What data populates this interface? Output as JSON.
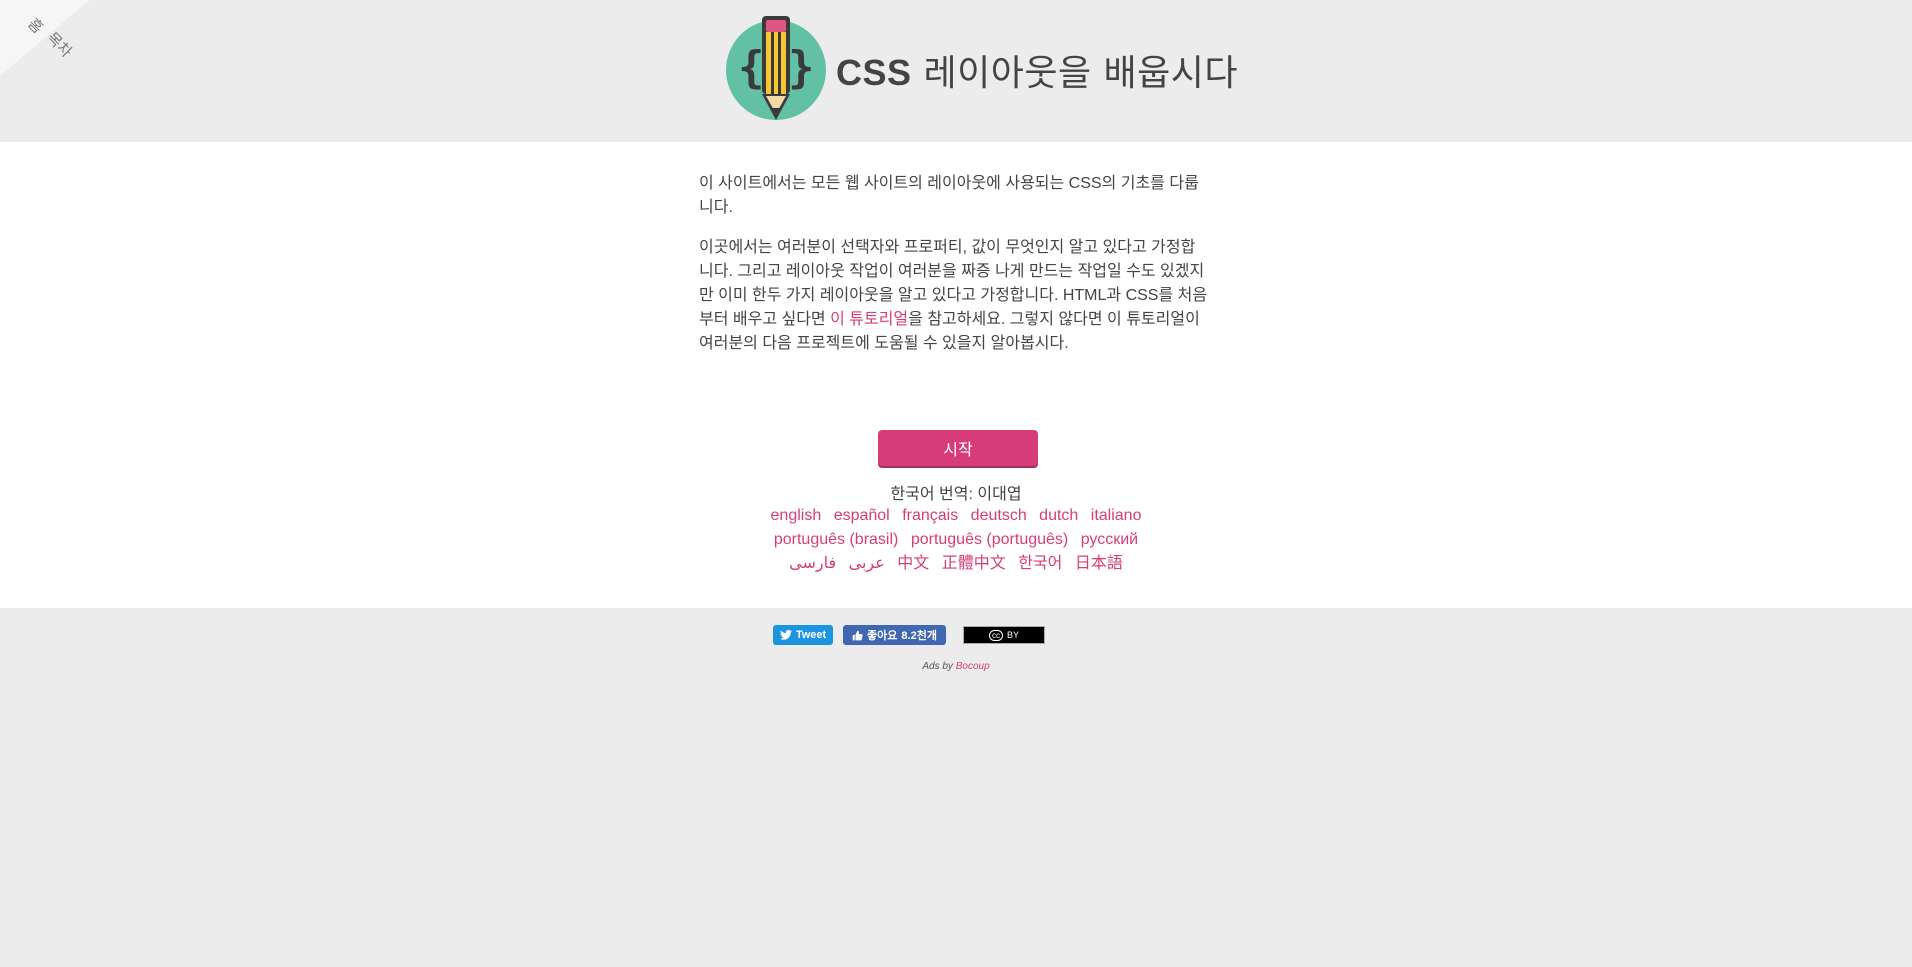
{
  "corner": {
    "toc_line1": "홈",
    "toc_line2": "목차"
  },
  "header": {
    "title_bold": "CSS",
    "title_rest": "레이아웃을 배웁시다"
  },
  "intro": {
    "p1": "이 사이트에서는 모든 웹 사이트의 레이아웃에 사용되는 CSS의 기초를 다룹니다.",
    "p2_before": "이곳에서는 여러분이 선택자와 프로퍼티, 값이 무엇인지 알고 있다고 가정합니다. 그리고 레이아웃 작업이 여러분을 짜증 나게 만드는 작업일 수도 있겠지만 이미 한두 가지 레이아웃을 알고 있다고 가정합니다. HTML과 CSS를 처음부터 배우고 싶다면 ",
    "p2_link": "이 튜토리얼",
    "p2_after": "을 참고하세요. 그렇지 않다면 이 튜토리얼이 여러분의 다음 프로젝트에 도움될 수 있을지 알아봅시다."
  },
  "start_button": "시작",
  "translator": "한국어 번역: 이대엽",
  "languages": [
    [
      "english",
      "español",
      "français",
      "deutsch",
      "dutch",
      "italiano"
    ],
    [
      "português (brasil)",
      "português (português)",
      "русский"
    ],
    [
      "عربى",
      "فارسی",
      "中文",
      "正體中文",
      "한국어",
      "日本語"
    ]
  ],
  "footer": {
    "tweet_label": "Tweet",
    "like_label": "좋아요",
    "like_count": "8.2천개",
    "cc_label": "BY",
    "ads_prefix": "Ads by ",
    "ads_link": "Bocoup"
  },
  "colors": {
    "accent": "#d63d78",
    "page_bg": "#ececec",
    "content_bg": "#ffffff",
    "logo_circle": "#62c1a4",
    "twitter": "#1b95e0",
    "facebook": "#4267b2"
  }
}
